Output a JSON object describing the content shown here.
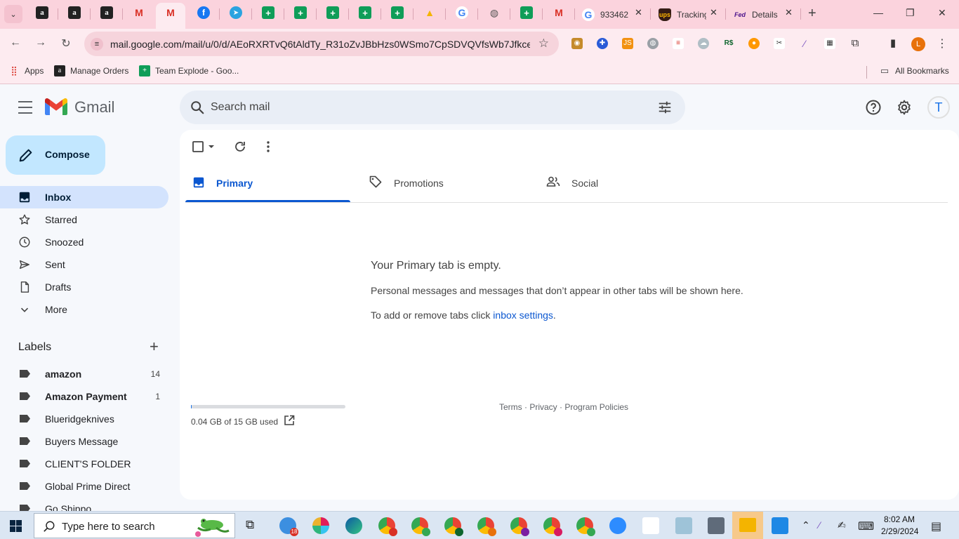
{
  "browser": {
    "tabs": [
      {
        "title": "933462",
        "favicon": "google-g-icon"
      },
      {
        "title": "Tracking",
        "favicon": "ups-icon"
      },
      {
        "title": "Details",
        "favicon": "fedex-icon"
      }
    ],
    "url": "mail.google.com/mail/u/0/d/AEoRXRTvQ6tAldTy_R31oZvJBbHzs0WSmo7CpSDVQVfsWb7Jfkce/...",
    "profile_initial": "L",
    "bookmarks": {
      "apps_label": "Apps",
      "items": [
        "Manage Orders",
        "Team Explode - Goo..."
      ],
      "all_bookmarks": "All Bookmarks"
    }
  },
  "gmail": {
    "product_name": "Gmail",
    "search": {
      "placeholder": "Search mail"
    },
    "avatar_initial": "T",
    "compose_label": "Compose",
    "nav": [
      {
        "label": "Inbox",
        "icon": "inbox-icon",
        "active": true
      },
      {
        "label": "Starred",
        "icon": "star-icon"
      },
      {
        "label": "Snoozed",
        "icon": "clock-icon"
      },
      {
        "label": "Sent",
        "icon": "send-icon"
      },
      {
        "label": "Drafts",
        "icon": "draft-icon"
      },
      {
        "label": "More",
        "icon": "chevron-down-icon"
      }
    ],
    "labels_header": "Labels",
    "labels": [
      {
        "name": "amazon",
        "count": "14",
        "bold": true
      },
      {
        "name": "Amazon Payment",
        "count": "1",
        "bold": true
      },
      {
        "name": "Blueridgeknives",
        "count": ""
      },
      {
        "name": "Buyers Message",
        "count": ""
      },
      {
        "name": "CLIENT'S FOLDER",
        "count": ""
      },
      {
        "name": "Global Prime Direct",
        "count": ""
      },
      {
        "name": "Go Shippo",
        "count": ""
      }
    ],
    "tabs": [
      {
        "label": "Primary",
        "icon": "inbox-tab-icon",
        "active": true
      },
      {
        "label": "Promotions",
        "icon": "tag-icon"
      },
      {
        "label": "Social",
        "icon": "people-icon"
      }
    ],
    "empty_state": {
      "title": "Your Primary tab is empty.",
      "description": "Personal messages and messages that don’t appear in other tabs will be shown here.",
      "hint_prefix": "To add or remove tabs click ",
      "hint_link": "inbox settings",
      "hint_suffix": "."
    },
    "storage": {
      "text": "0.04 GB of 15 GB used",
      "fraction": 0.003
    },
    "footer": {
      "terms": "Terms",
      "privacy": "Privacy",
      "policies": "Program Policies",
      "separator": " · "
    }
  },
  "taskbar": {
    "search_placeholder": "Type here to search",
    "mail_badge": "18",
    "time": "8:02 AM",
    "date": "2/29/2024",
    "colors": {
      "accent": "#0b57d0",
      "compose": "#c2e7ff",
      "active_nav": "#d3e3fd",
      "browser_frame": "#fbd3dd"
    }
  }
}
